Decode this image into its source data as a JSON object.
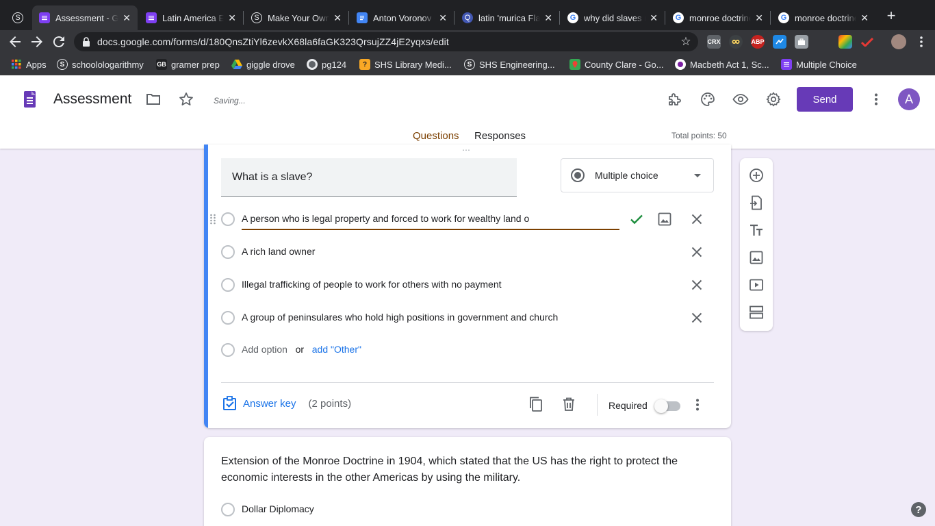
{
  "browser": {
    "tabs": [
      {
        "title": "",
        "favicon": "schoology-icon"
      },
      {
        "title": "Assessment - Google Forms",
        "favicon": "forms-icon",
        "active": true
      },
      {
        "title": "Latin America Exit Ticket",
        "favicon": "forms-icon"
      },
      {
        "title": "Make Your Own",
        "favicon": "schoology-icon"
      },
      {
        "title": "Anton Voronov - Docs",
        "favicon": "docs-icon"
      },
      {
        "title": "latin 'murica Flashcards",
        "favicon": "quizlet-icon"
      },
      {
        "title": "why did slaves rebel",
        "favicon": "google-icon"
      },
      {
        "title": "monroe doctrine",
        "favicon": "google-icon"
      },
      {
        "title": "monroe doctrine",
        "favicon": "google-icon"
      }
    ],
    "url": "docs.google.com/forms/d/180QnsZtiYl6zevkX68la6faGK323QrsujZZ4jE2yqxs/edit",
    "bookmarks": [
      {
        "label": "Apps"
      },
      {
        "label": "schoolologarithmy"
      },
      {
        "label": "gramer prep"
      },
      {
        "label": "giggle drove"
      },
      {
        "label": "pg124"
      },
      {
        "label": "SHS Library Medi..."
      },
      {
        "label": "SHS Engineering..."
      },
      {
        "label": "County Clare - Go..."
      },
      {
        "label": "Macbeth Act 1, Sc..."
      },
      {
        "label": "Multiple Choice"
      }
    ],
    "extensions": {
      "crx": "CRX",
      "abp": "ABP"
    }
  },
  "header": {
    "title": "Assessment",
    "status": "Saving...",
    "send_label": "Send",
    "avatar_letter": "A",
    "tabs": {
      "questions": "Questions",
      "responses": "Responses"
    },
    "total_points": "Total points: 50"
  },
  "question1": {
    "title": "What is a slave?",
    "type": "Multiple choice",
    "options": [
      "A person who is legal property and forced to work for wealthy land o",
      "A rich land owner",
      "Illegal trafficking of people to work for others with no payment",
      "A group of peninsulares who hold high positions in government and church"
    ],
    "add_option": "Add option",
    "or": "or",
    "add_other": "add \"Other\"",
    "answer_key": "Answer key",
    "points": "(2 points)",
    "required_label": "Required"
  },
  "question2": {
    "title": "Extension of the Monroe Doctrine in 1904, which stated that the US has the right to protect the economic interests in the other Americas by using the military.",
    "options": [
      "Dollar Diplomacy"
    ]
  },
  "help": "?",
  "colors": {
    "brand": "#673ab7",
    "accent_blue": "#4285f4",
    "active_underline": "#7b3f00",
    "background": "#f0ebf8"
  }
}
